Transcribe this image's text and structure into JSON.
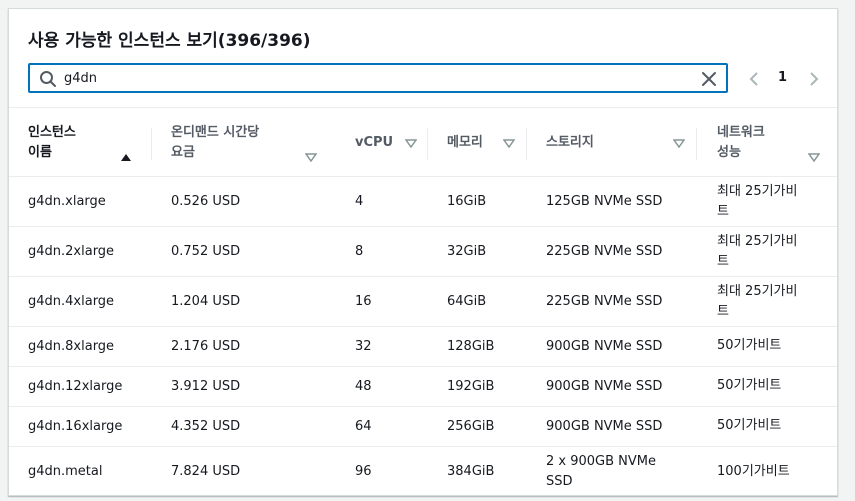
{
  "title": "사용 가능한 인스턴스 보기(396/396)",
  "search": {
    "value": "g4dn",
    "placeholder": ""
  },
  "pagination": {
    "current_page": "1"
  },
  "columns": [
    {
      "line1": "인스턴스",
      "line2": "이름"
    },
    {
      "line1": "온디맨드 시간당",
      "line2": "요금"
    },
    {
      "line1": "vCPU",
      "line2": ""
    },
    {
      "line1": "메모리",
      "line2": ""
    },
    {
      "line1": "스토리지",
      "line2": ""
    },
    {
      "line1": "네트워크",
      "line2": "성능"
    }
  ],
  "rows": [
    {
      "name": "g4dn.xlarge",
      "price": "0.526 USD",
      "vcpu": "4",
      "memory": "16GiB",
      "storage1": "125GB NVMe SSD",
      "storage2": "",
      "network1": "최대 25기가비",
      "network2": "트"
    },
    {
      "name": "g4dn.2xlarge",
      "price": "0.752 USD",
      "vcpu": "8",
      "memory": "32GiB",
      "storage1": "225GB NVMe SSD",
      "storage2": "",
      "network1": "최대 25기가비",
      "network2": "트"
    },
    {
      "name": "g4dn.4xlarge",
      "price": "1.204 USD",
      "vcpu": "16",
      "memory": "64GiB",
      "storage1": "225GB NVMe SSD",
      "storage2": "",
      "network1": "최대 25기가비",
      "network2": "트"
    },
    {
      "name": "g4dn.8xlarge",
      "price": "2.176 USD",
      "vcpu": "32",
      "memory": "128GiB",
      "storage1": "900GB NVMe SSD",
      "storage2": "",
      "network1": "50기가비트",
      "network2": ""
    },
    {
      "name": "g4dn.12xlarge",
      "price": "3.912 USD",
      "vcpu": "48",
      "memory": "192GiB",
      "storage1": "900GB NVMe SSD",
      "storage2": "",
      "network1": "50기가비트",
      "network2": ""
    },
    {
      "name": "g4dn.16xlarge",
      "price": "4.352 USD",
      "vcpu": "64",
      "memory": "256GiB",
      "storage1": "900GB NVMe SSD",
      "storage2": "",
      "network1": "50기가비트",
      "network2": ""
    },
    {
      "name": "g4dn.metal",
      "price": "7.824 USD",
      "vcpu": "96",
      "memory": "384GiB",
      "storage1": "2 x 900GB NVMe",
      "storage2": "SSD",
      "network1": "100기가비트",
      "network2": ""
    }
  ],
  "colors": {
    "accent": "#0073bb",
    "border": "#eaeded",
    "header_text": "#545b64"
  },
  "icons": {
    "search": "search-icon",
    "clear": "close-icon",
    "prev": "chevron-left-icon",
    "next": "chevron-right-icon",
    "sort_asc": "sort-ascending-icon",
    "sort": "sort-icon"
  }
}
